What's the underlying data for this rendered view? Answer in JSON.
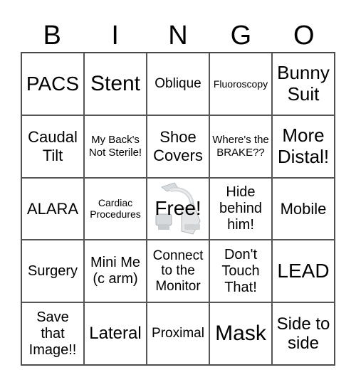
{
  "header": [
    "B",
    "I",
    "N",
    "G",
    "O"
  ],
  "cells": [
    [
      "PACS",
      "Stent",
      "Oblique",
      "Fluoroscopy",
      "Bunny Suit"
    ],
    [
      "Caudal Tilt",
      "My Back's Not Sterile!",
      "Shoe Covers",
      "Where's the BRAKE??",
      "More Distal!"
    ],
    [
      "ALARA",
      "Cardiac Procedures",
      "Free!",
      "Hide behind him!",
      "Mobile"
    ],
    [
      "Surgery",
      "Mini Me (c arm)",
      "Connect to the Monitor",
      "Don't Touch That!",
      "LEAD"
    ],
    [
      "Save that Image!!",
      "Lateral",
      "Proximal",
      "Mask",
      "Side to side"
    ]
  ],
  "free_space_image": "c-arm-xray-machine"
}
